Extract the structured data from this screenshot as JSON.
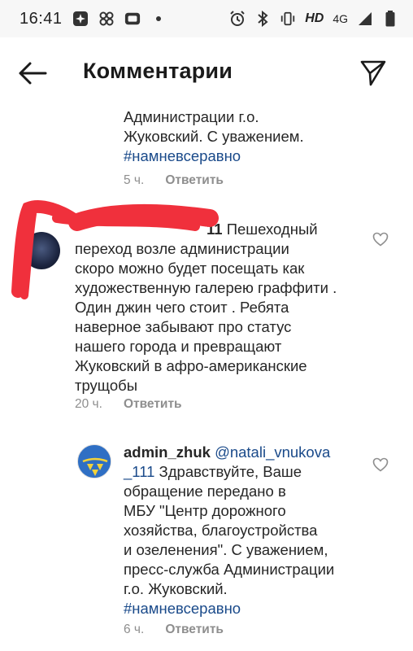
{
  "status_bar": {
    "time": "16:41",
    "hd_label": "HD",
    "network_label": "4G"
  },
  "header": {
    "title": "Комментарии",
    "back_icon": "arrow-left-icon",
    "send_icon": "paper-plane-icon"
  },
  "comments": [
    {
      "text_lines": [
        "Администрации г.о.",
        "Жуковский. С уважением."
      ],
      "hashtag": "#намневсеравно",
      "time": "5 ч.",
      "reply_label": "Ответить"
    },
    {
      "username_suffix": "11",
      "text_lines": [
        " Пешеходный",
        "переход возле администрации",
        "скоро можно будет посещать как",
        "художественную галерею граффити .",
        "Один джин чего стоит . Ребята",
        "наверное забывают про статус",
        "нашего города и превращают",
        "Жуковский в афро-американские",
        "трущобы"
      ],
      "time": "20 ч.",
      "reply_label": "Ответить",
      "redaction_color": "#f0303c"
    },
    {
      "username": "admin_zhuk",
      "mention_line1": "@natali_vnukova",
      "mention_line2": "_111",
      "text_lines": [
        " Здравствуйте, Ваше",
        "обращение передано в",
        "МБУ \"Центр дорожного",
        "хозяйства, благоустройства",
        "и озеленения\". С уважением,",
        "пресс-служба Администрации",
        "г.о. Жуковский."
      ],
      "hashtag": "#намневсеравно",
      "time": "6 ч.",
      "reply_label": "Ответить"
    }
  ],
  "colors": {
    "hashtag": "#1a4a8a",
    "meta_gray": "#8e8e8e",
    "avatar_blue": "#2f6fc4"
  }
}
